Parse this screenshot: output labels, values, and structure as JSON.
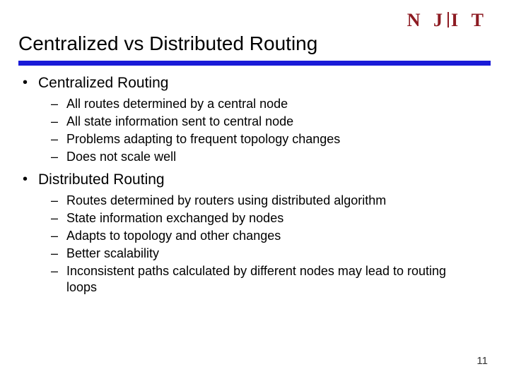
{
  "logo": {
    "text": "N J I T"
  },
  "title": "Centralized vs Distributed Routing",
  "sections": [
    {
      "heading": "Centralized Routing",
      "items": [
        "All routes determined by a central node",
        "All state information sent to central node",
        "Problems adapting to frequent topology changes",
        "Does not scale well"
      ]
    },
    {
      "heading": "Distributed Routing",
      "items": [
        "Routes determined by routers using distributed algorithm",
        "State information exchanged by nodes",
        "Adapts to topology and other changes",
        "Better scalability",
        "Inconsistent paths calculated by different nodes may lead to routing loops"
      ]
    }
  ],
  "page_number": "11",
  "glyphs": {
    "dot": "•",
    "dash": "–"
  }
}
